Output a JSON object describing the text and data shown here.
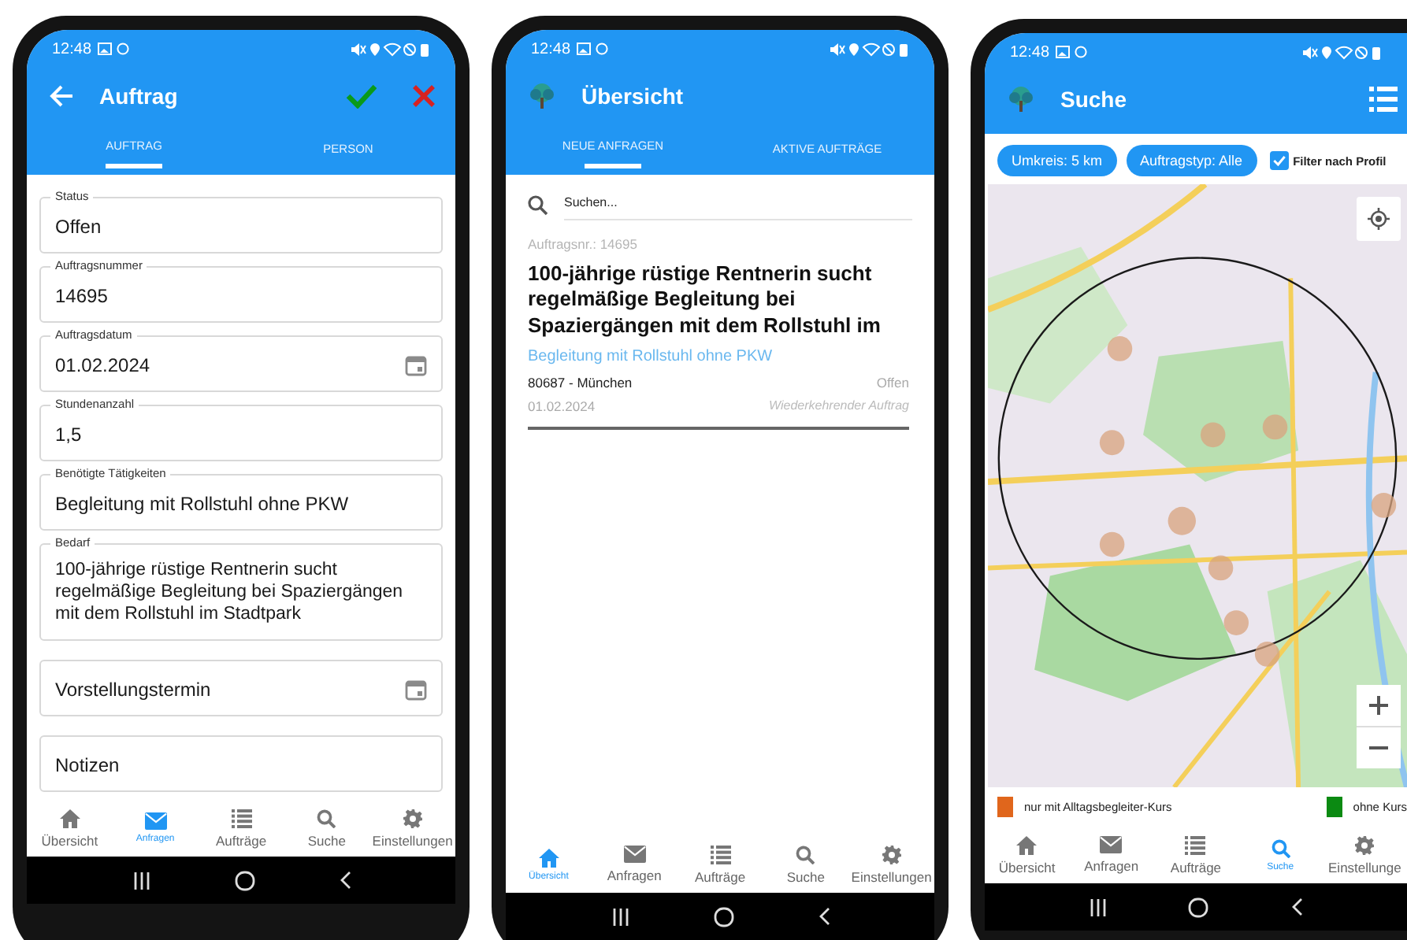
{
  "phones": [
    {
      "kind": "form",
      "status_bar": {
        "time": "12:48"
      },
      "app_bar": {
        "title": "Auftrag"
      },
      "tabs": [
        {
          "label": "AUFTRAG",
          "selected": true
        },
        {
          "label": "PERSON",
          "selected": false
        }
      ],
      "fields": [
        {
          "kind": "text",
          "label": "Status",
          "value": "Offen"
        },
        {
          "kind": "text",
          "label": "Auftragsnummer",
          "value": "14695"
        },
        {
          "kind": "date",
          "label": "Auftragsdatum",
          "value": "01.02.2024"
        },
        {
          "kind": "text",
          "label": "Stundenanzahl",
          "value": "1,5"
        },
        {
          "kind": "text",
          "label": "Benötigte Tätigkeiten",
          "value": "Begleitung mit Rollstuhl ohne PKW"
        },
        {
          "kind": "textarea",
          "label": "Bedarf",
          "value": "100-jährige rüstige Rentnerin sucht regelmäßige Begleitung bei Spaziergängen mit dem Rollstuhl im Stadtpark"
        },
        {
          "kind": "date",
          "placeholder": "Vorstellungstermin"
        },
        {
          "kind": "text",
          "placeholder": "Notizen"
        }
      ],
      "nav": [
        {
          "label": "Übersicht",
          "selected": false
        },
        {
          "label": "Anfragen",
          "selected": true
        },
        {
          "label": "Aufträge",
          "selected": false
        },
        {
          "label": "Suche",
          "selected": false
        },
        {
          "label": "Einstellungen",
          "selected": false
        }
      ]
    },
    {
      "kind": "list",
      "status_bar": {
        "time": "12:48"
      },
      "app_bar": {
        "title": "Übersicht"
      },
      "tabs": [
        {
          "label": "NEUE ANFRAGEN",
          "selected": true
        },
        {
          "label": "AKTIVE AUFTRÄGE",
          "selected": false
        }
      ],
      "search": {
        "placeholder": "Suchen..."
      },
      "cards": [
        {
          "order_no": "Auftragsnr.: 14695",
          "title": "100-jährige rüstige Rentnerin sucht regelmäßige Begleitung bei Spaziergängen mit dem Rollstuhl im",
          "activity": "Begleitung mit Rollstuhl ohne PKW",
          "location": "80687 - München",
          "status": "Offen",
          "date": "01.02.2024",
          "recurrence": "Wiederkehrender Auftrag"
        }
      ],
      "nav": [
        {
          "label": "Übersicht",
          "selected": true
        },
        {
          "label": "Anfragen",
          "selected": false
        },
        {
          "label": "Aufträge",
          "selected": false
        },
        {
          "label": "Suche",
          "selected": false
        },
        {
          "label": "Einstellungen",
          "selected": false
        }
      ]
    },
    {
      "kind": "map",
      "status_bar": {
        "time": "12:48"
      },
      "app_bar": {
        "title": "Suche"
      },
      "chips": [
        "Umkreis: 5 km",
        "Auftragstyp: Alle"
      ],
      "filter": {
        "label": "Filter nach Profil",
        "checked": true
      },
      "map": {
        "kind": "picture"
      },
      "legend": [
        {
          "label": "nur mit Alltagsbegleiter-Kurs",
          "color": "#e0661c"
        },
        {
          "label": "ohne Kurs",
          "color": "#0b8a12"
        }
      ],
      "nav": [
        {
          "label": "Übersicht",
          "selected": false
        },
        {
          "label": "Anfragen",
          "selected": false
        },
        {
          "label": "Aufträge",
          "selected": false
        },
        {
          "label": "Suche",
          "selected": true
        },
        {
          "label": "Einstellunge",
          "selected": false
        }
      ]
    }
  ]
}
